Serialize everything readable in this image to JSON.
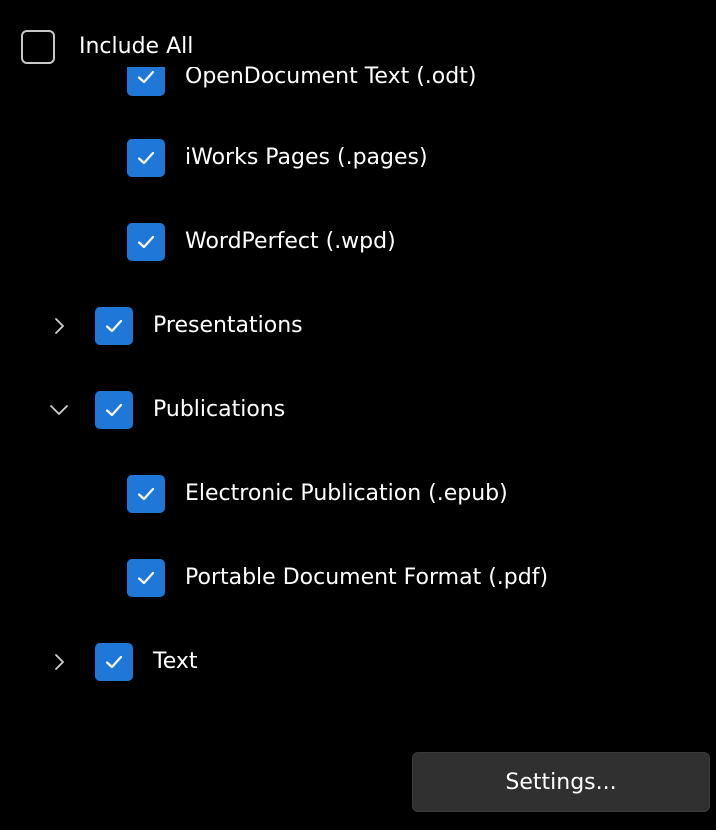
{
  "include_all": {
    "label": "Include All",
    "checked": false
  },
  "tree": {
    "clipped_item": {
      "label": "OpenDocument Text (.odt)",
      "checked": true
    },
    "items": [
      {
        "label": "iWorks Pages (.pages)",
        "checked": true,
        "level": 2
      },
      {
        "label": "WordPerfect (.wpd)",
        "checked": true,
        "level": 2
      },
      {
        "label": "Presentations",
        "checked": true,
        "level": 1,
        "expanded": false
      },
      {
        "label": "Publications",
        "checked": true,
        "level": 1,
        "expanded": true
      },
      {
        "label": "Electronic Publication (.epub)",
        "checked": true,
        "level": 2
      },
      {
        "label": "Portable Document Format (.pdf)",
        "checked": true,
        "level": 2
      },
      {
        "label": "Text",
        "checked": true,
        "level": 1,
        "expanded": false
      }
    ]
  },
  "settings_button": {
    "label": "Settings..."
  },
  "colors": {
    "background": "#000000",
    "checkbox_fill": "#1f78d8",
    "button_fill": "#303030",
    "text": "#ffffff"
  },
  "icons": {
    "check": "check-icon",
    "collapsed": "chevron-right-icon",
    "expanded": "chevron-down-icon"
  }
}
